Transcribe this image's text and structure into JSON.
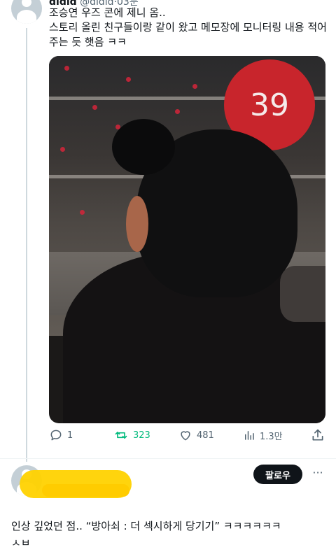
{
  "tweet": {
    "display_name": "didid",
    "handle_time": "@didid·03분",
    "lines": [
      "조승연 우즈 콘에 제니 옴..",
      "스토리 올린 친구들이랑 같이 왔고 메모장에 모니터링 내용 적어",
      "주는 듯 햇음 ㅋㅋ"
    ],
    "media": {
      "sign_number": "39"
    },
    "actions": {
      "replies": "1",
      "retweets": "323",
      "likes": "481",
      "views": "1.3만"
    }
  },
  "reply": {
    "follow_label": "팔로우",
    "more_label": "···",
    "lines": [
      "인상 깊었던 점..  “방아쇠 : 더 섹시하게 당기기” ㅋㅋㅋㅋㅋㅋ",
      "ㅅㅂ"
    ]
  },
  "colors": {
    "text": "#0f1419",
    "secondary": "#536471",
    "retweet_green": "#00ba7c",
    "follow_bg": "#0f1419",
    "redaction": "#ffd200"
  }
}
